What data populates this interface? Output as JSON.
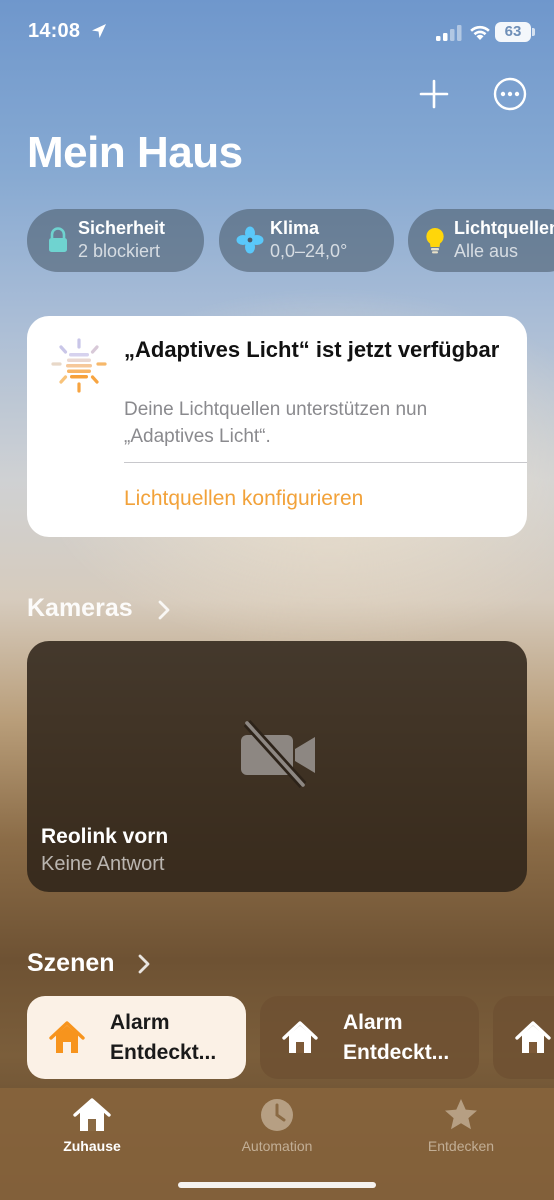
{
  "status_bar": {
    "time": "14:08",
    "battery": "63",
    "icons": [
      "location-arrow-icon",
      "cellular-signal-icon",
      "wifi-icon",
      "battery-icon"
    ]
  },
  "header": {
    "title": "Mein Haus",
    "add_icon": "plus-icon",
    "more_icon": "ellipsis-circle-icon"
  },
  "chips": [
    {
      "title": "Sicherheit",
      "subtitle": "2 blockiert",
      "icon": "lock-icon",
      "icon_color": "#6fd3d0"
    },
    {
      "title": "Klima",
      "subtitle": "0,0–24,0°",
      "icon": "fan-icon",
      "icon_color": "#5ac8fa"
    },
    {
      "title": "Lichtquellen",
      "subtitle": "Alle aus",
      "icon": "lightbulb-icon",
      "icon_color": "#ffd60a"
    }
  ],
  "adaptive_card": {
    "title": "„Adaptives Licht“ ist jetzt verfügbar",
    "body": "Deine Lichtquellen unterstützen nun „Adaptives Licht“.",
    "action": "Lichtquellen konfigurieren",
    "action_color": "#f2a23a",
    "icon": "adaptive-sun-icon"
  },
  "cameras": {
    "section_title": "Kameras",
    "camera": {
      "name": "Reolink vorn",
      "status": "Keine Antwort",
      "icon": "video-slash-icon"
    }
  },
  "scenes": {
    "section_title": "Szenen",
    "items": [
      {
        "label": "Alarm\nEntdeckt...",
        "icon": "house-icon",
        "active": true,
        "icon_color": "#f7941d"
      },
      {
        "label": "Alarm\nEntdeckt...",
        "icon": "house-icon",
        "active": false
      },
      {
        "label": "",
        "icon": "house-icon",
        "active": false
      }
    ]
  },
  "tab_bar": {
    "tabs": [
      {
        "label": "Zuhause",
        "icon": "house-fill-icon",
        "selected": true
      },
      {
        "label": "Automation",
        "icon": "clock-icon",
        "selected": false
      },
      {
        "label": "Entdecken",
        "icon": "star-icon",
        "selected": false
      }
    ]
  },
  "colors": {
    "accent": "#f2a23a",
    "card_background": "#ffffff"
  }
}
